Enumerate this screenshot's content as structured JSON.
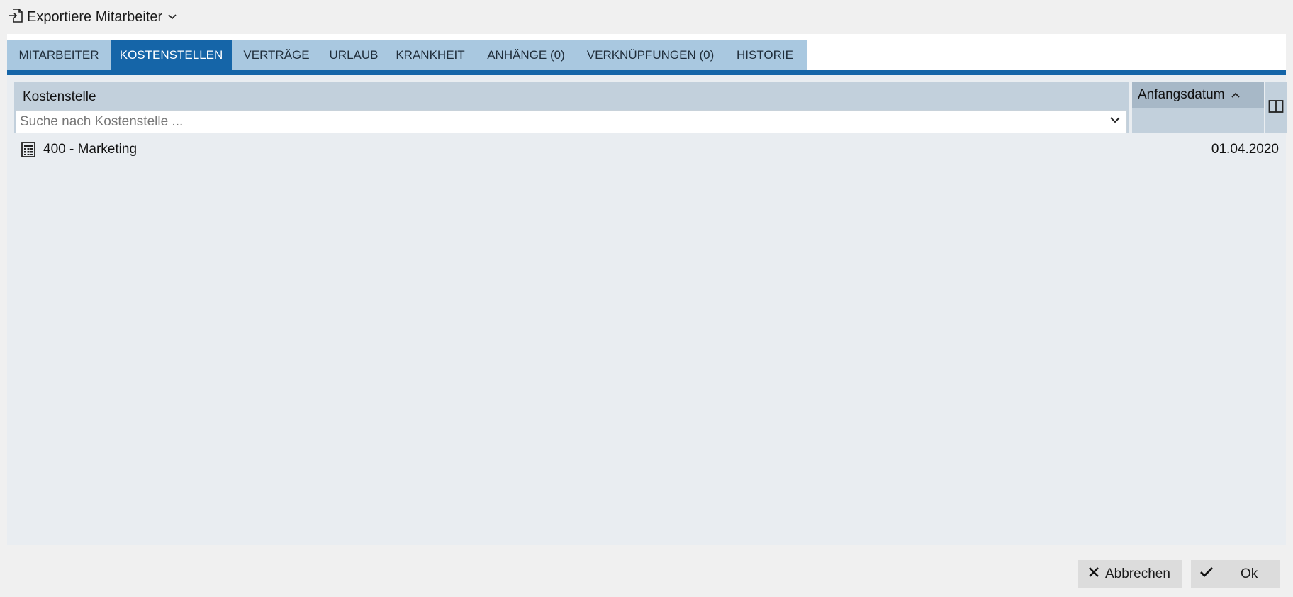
{
  "header": {
    "export_label": "Exportiere Mitarbeiter"
  },
  "tabs": [
    {
      "label": "MITARBEITER",
      "active": false
    },
    {
      "label": "KOSTENSTELLEN",
      "active": true
    },
    {
      "label": "VERTRÄGE",
      "active": false
    },
    {
      "label": "URLAUB",
      "active": false
    },
    {
      "label": "KRANKHEIT",
      "active": false
    },
    {
      "label": "ANHÄNGE (0)",
      "active": false
    },
    {
      "label": "VERKNÜPFUNGEN (0)",
      "active": false
    },
    {
      "label": "HISTORIE",
      "active": false
    }
  ],
  "grid": {
    "columns": {
      "cost_center": "Kostenstelle",
      "start_date": "Anfangsdatum"
    },
    "search_placeholder": "Suche nach Kostenstelle ...",
    "rows": [
      {
        "cost_center": "400 - Marketing",
        "start_date": "01.04.2020",
        "icon": "calculator-icon"
      }
    ]
  },
  "footer": {
    "cancel_label": "Abbrechen",
    "ok_label": "Ok"
  },
  "colors": {
    "tab_active": "#1565a8",
    "tab_inactive": "#a9c8e0",
    "content_bg": "#e9edf1",
    "header_bg": "#c2d0dc"
  }
}
